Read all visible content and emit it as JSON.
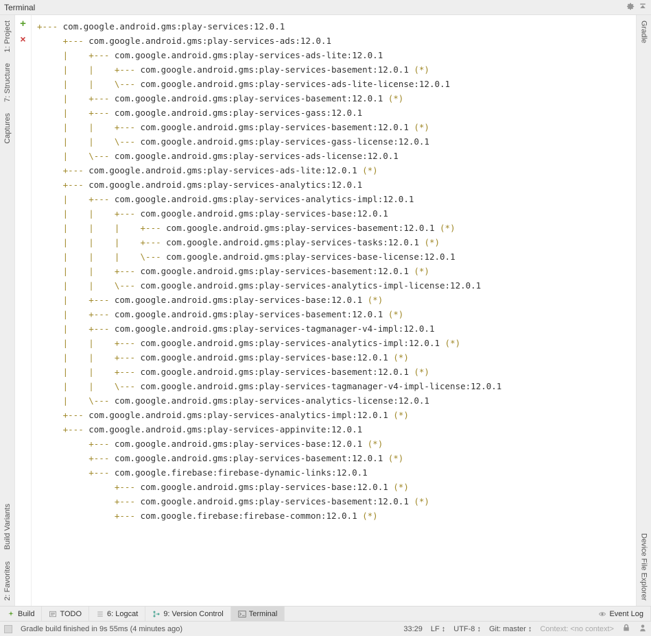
{
  "header": {
    "title": "Terminal"
  },
  "left_rail": {
    "top": [
      {
        "label": "1: Project",
        "name": "project-tab"
      },
      {
        "label": "7: Structure",
        "name": "structure-tab"
      },
      {
        "label": "Captures",
        "name": "captures-tab"
      }
    ],
    "bottom": [
      {
        "label": "Build Variants",
        "name": "build-variants-tab"
      },
      {
        "label": "2: Favorites",
        "name": "favorites-tab"
      }
    ]
  },
  "right_rail": {
    "top": [
      {
        "label": "Gradle",
        "name": "gradle-tab"
      }
    ],
    "bottom": [
      {
        "label": "Device File Explorer",
        "name": "device-file-explorer-tab"
      }
    ]
  },
  "tree": [
    {
      "depth": 0,
      "branch": "+--- ",
      "text": "com.google.android.gms:play-services:12.0.1"
    },
    {
      "depth": 1,
      "branch": "+--- ",
      "text": "com.google.android.gms:play-services-ads:12.0.1"
    },
    {
      "depth": 2,
      "branch": "+--- ",
      "text": "com.google.android.gms:play-services-ads-lite:12.0.1"
    },
    {
      "depth": 3,
      "branch": "+--- ",
      "text": "com.google.android.gms:play-services-basement:12.0.1",
      "star": true
    },
    {
      "depth": 3,
      "branch": "\\--- ",
      "text": "com.google.android.gms:play-services-ads-lite-license:12.0.1"
    },
    {
      "depth": 2,
      "branch": "+--- ",
      "text": "com.google.android.gms:play-services-basement:12.0.1",
      "star": true
    },
    {
      "depth": 2,
      "branch": "+--- ",
      "text": "com.google.android.gms:play-services-gass:12.0.1"
    },
    {
      "depth": 3,
      "branch": "+--- ",
      "text": "com.google.android.gms:play-services-basement:12.0.1",
      "star": true
    },
    {
      "depth": 3,
      "branch": "\\--- ",
      "text": "com.google.android.gms:play-services-gass-license:12.0.1"
    },
    {
      "depth": 2,
      "branch": "\\--- ",
      "text": "com.google.android.gms:play-services-ads-license:12.0.1"
    },
    {
      "depth": 1,
      "branch": "+--- ",
      "text": "com.google.android.gms:play-services-ads-lite:12.0.1",
      "star": true
    },
    {
      "depth": 1,
      "branch": "+--- ",
      "text": "com.google.android.gms:play-services-analytics:12.0.1"
    },
    {
      "depth": 2,
      "branch": "+--- ",
      "text": "com.google.android.gms:play-services-analytics-impl:12.0.1"
    },
    {
      "depth": 3,
      "branch": "+--- ",
      "text": "com.google.android.gms:play-services-base:12.0.1"
    },
    {
      "depth": 4,
      "branch": "+--- ",
      "text": "com.google.android.gms:play-services-basement:12.0.1",
      "star": true
    },
    {
      "depth": 4,
      "branch": "+--- ",
      "text": "com.google.android.gms:play-services-tasks:12.0.1",
      "star": true
    },
    {
      "depth": 4,
      "branch": "\\--- ",
      "text": "com.google.android.gms:play-services-base-license:12.0.1"
    },
    {
      "depth": 3,
      "branch": "+--- ",
      "text": "com.google.android.gms:play-services-basement:12.0.1",
      "star": true
    },
    {
      "depth": 3,
      "branch": "\\--- ",
      "text": "com.google.android.gms:play-services-analytics-impl-license:12.0.1"
    },
    {
      "depth": 2,
      "branch": "+--- ",
      "text": "com.google.android.gms:play-services-base:12.0.1",
      "star": true
    },
    {
      "depth": 2,
      "branch": "+--- ",
      "text": "com.google.android.gms:play-services-basement:12.0.1",
      "star": true
    },
    {
      "depth": 2,
      "branch": "+--- ",
      "text": "com.google.android.gms:play-services-tagmanager-v4-impl:12.0.1"
    },
    {
      "depth": 3,
      "branch": "+--- ",
      "text": "com.google.android.gms:play-services-analytics-impl:12.0.1",
      "star": true
    },
    {
      "depth": 3,
      "branch": "+--- ",
      "text": "com.google.android.gms:play-services-base:12.0.1",
      "star": true
    },
    {
      "depth": 3,
      "branch": "+--- ",
      "text": "com.google.android.gms:play-services-basement:12.0.1",
      "star": true
    },
    {
      "depth": 3,
      "branch": "\\--- ",
      "text": "com.google.android.gms:play-services-tagmanager-v4-impl-license:12.0.1"
    },
    {
      "depth": 2,
      "branch": "\\--- ",
      "text": "com.google.android.gms:play-services-analytics-license:12.0.1"
    },
    {
      "depth": 1,
      "branch": "+--- ",
      "text": "com.google.android.gms:play-services-analytics-impl:12.0.1",
      "star": true
    },
    {
      "depth": 1,
      "branch": "+--- ",
      "text": "com.google.android.gms:play-services-appinvite:12.0.1"
    },
    {
      "depth": 2,
      "branch": "+--- ",
      "text": "com.google.android.gms:play-services-base:12.0.1",
      "star": true
    },
    {
      "depth": 2,
      "branch": "+--- ",
      "text": "com.google.android.gms:play-services-basement:12.0.1",
      "star": true
    },
    {
      "depth": 2,
      "branch": "+--- ",
      "text": "com.google.firebase:firebase-dynamic-links:12.0.1"
    },
    {
      "depth": 3,
      "branch": "+--- ",
      "text": "com.google.android.gms:play-services-base:12.0.1",
      "star": true
    },
    {
      "depth": 3,
      "branch": "+--- ",
      "text": "com.google.android.gms:play-services-basement:12.0.1",
      "star": true
    },
    {
      "depth": 3,
      "branch": "+--- ",
      "text": "com.google.firebase:firebase-common:12.0.1",
      "star": true
    }
  ],
  "bottom_tabs": [
    {
      "label": "Build",
      "name": "build-tab",
      "active": false
    },
    {
      "label": "TODO",
      "name": "todo-tab",
      "active": false
    },
    {
      "label": "6: Logcat",
      "name": "logcat-tab",
      "active": false
    },
    {
      "label": "9: Version Control",
      "name": "version-control-tab",
      "active": false
    },
    {
      "label": "Terminal",
      "name": "terminal-tab",
      "active": true
    },
    {
      "label": "Event Log",
      "name": "event-log-tab",
      "active": false,
      "align": "right"
    }
  ],
  "status": {
    "message": "Gradle build finished in 9s 55ms (4 minutes ago)",
    "pos": "33:29",
    "le": "LF",
    "enc": "UTF-8",
    "git": "Git: master",
    "context": "Context: <no context>"
  }
}
